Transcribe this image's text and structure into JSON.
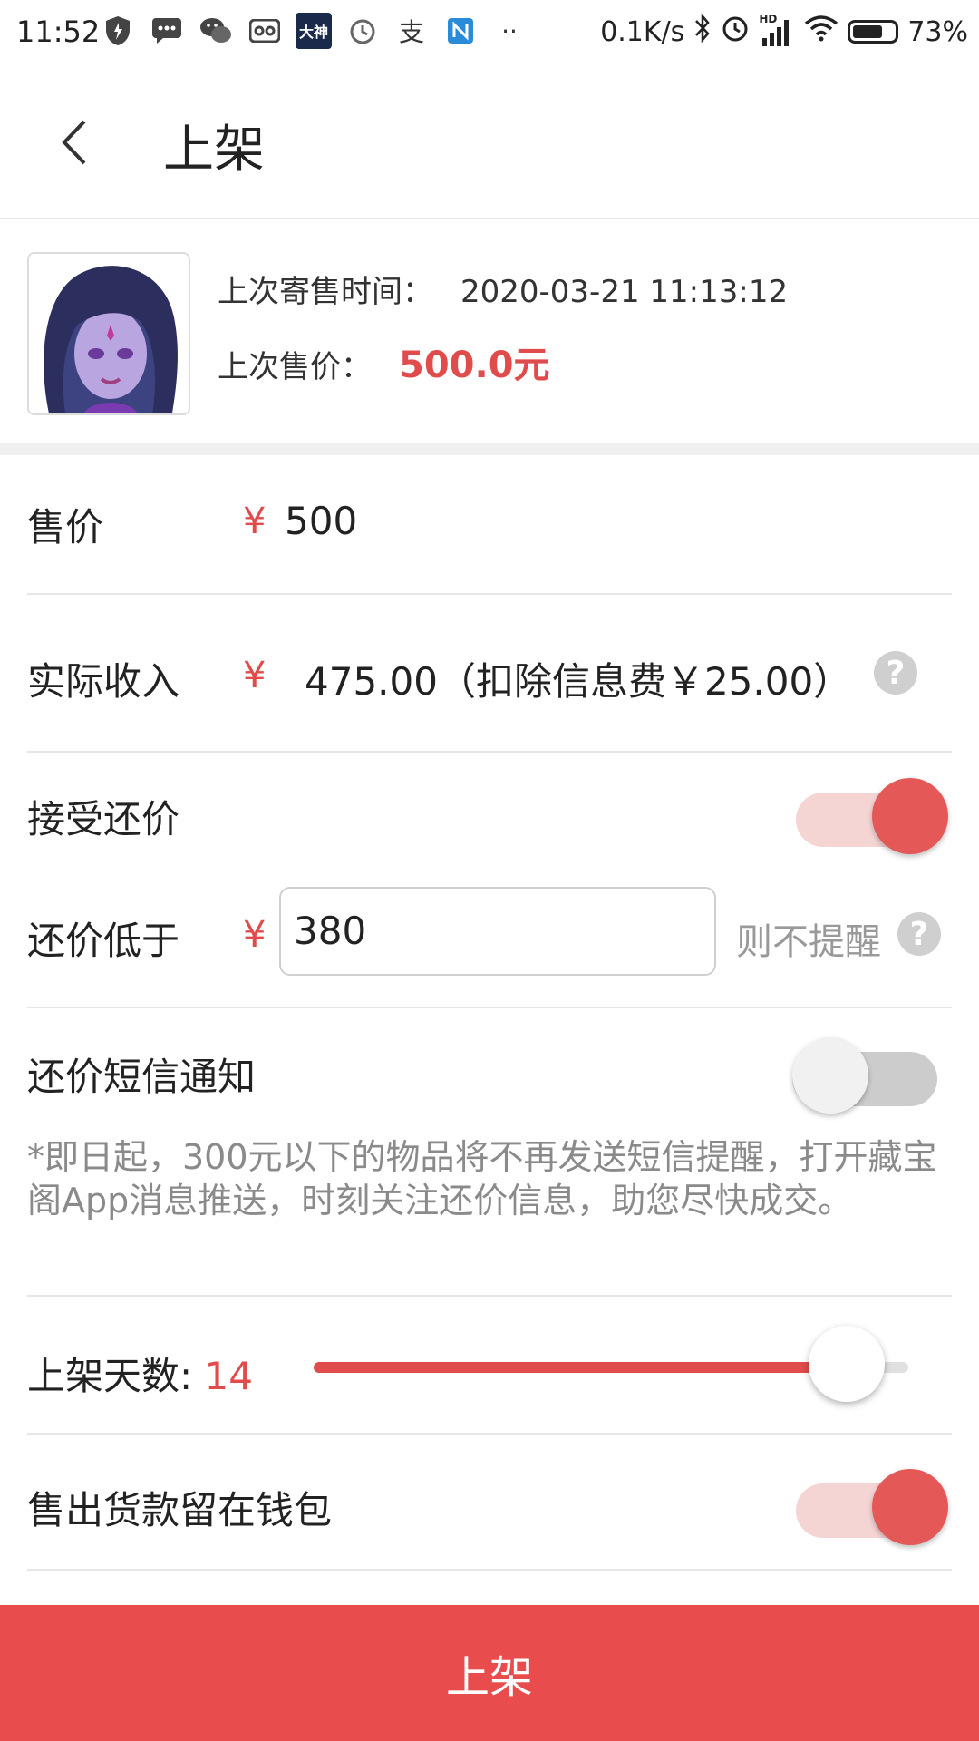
{
  "status_bar": {
    "time": "11:52",
    "badge_text": "大神",
    "network_speed": "0.1K/s",
    "signal_tag": "HD",
    "battery_percent": "73%",
    "battery_level": 0.73,
    "icons": [
      "shield-icon",
      "message-icon",
      "wechat-icon",
      "voicemail-icon",
      "dashen-app-icon",
      "alarm-icon",
      "alipay-icon",
      "n-app-icon",
      "more-dots-icon",
      "bluetooth-icon",
      "alarm-clock-icon",
      "signal-icon",
      "wifi-icon",
      "battery-icon"
    ]
  },
  "header": {
    "title": "上架",
    "back_icon": "back-chevron-icon"
  },
  "item": {
    "last_sale_time_label": "上次寄售时间：",
    "last_sale_time": "2020-03-21 11:13:12",
    "last_price_label": "上次售价：",
    "last_price": "500.0元"
  },
  "form": {
    "price": {
      "label": "售价",
      "currency": "¥",
      "value": "500"
    },
    "income": {
      "label": "实际收入",
      "currency": "¥",
      "value": "475.00（扣除信息费￥25.00）",
      "help": "?"
    },
    "accept_bargain": {
      "label": "接受还价",
      "enabled": true
    },
    "bargain_floor": {
      "label": "还价低于",
      "currency": "¥",
      "value": "380",
      "suffix": "则不提醒",
      "help": "?"
    },
    "sms_notify": {
      "label": "还价短信通知",
      "enabled": false
    },
    "notice": "*即日起，300元以下的物品将不再发送短信提醒，打开藏宝阁App消息推送，时刻关注还价信息，助您尽快成交。",
    "days": {
      "label": "上架天数:",
      "value": "14",
      "fraction": 0.96
    },
    "keep_in_wallet": {
      "label": "售出货款留在钱包",
      "enabled": true
    }
  },
  "submit_label": "上架",
  "colors": {
    "accent": "#e04b4b",
    "button": "#e84c4c",
    "switch_track_on": "#f5d4d4",
    "switch_track_off": "#cccccc"
  }
}
